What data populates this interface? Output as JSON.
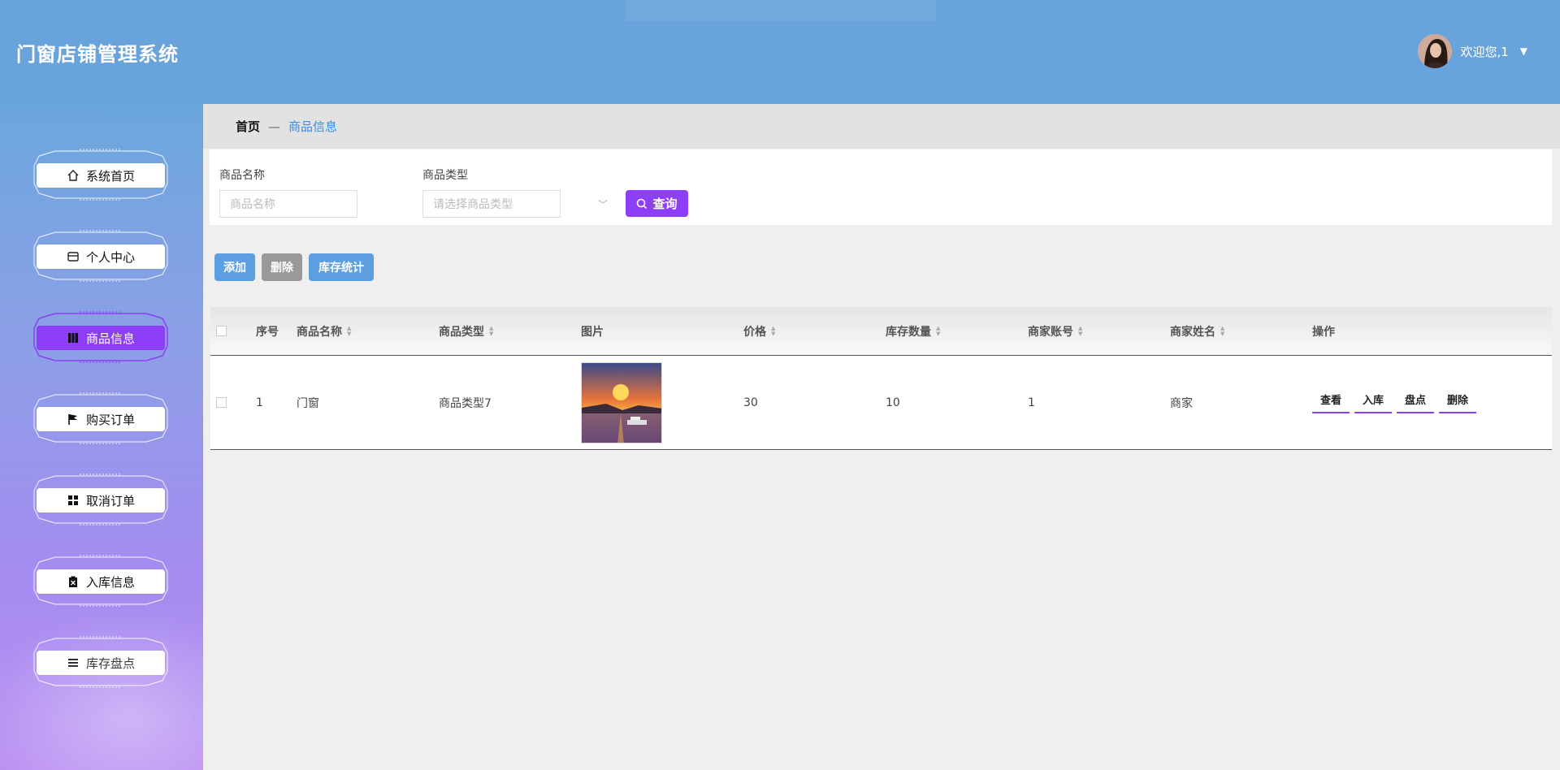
{
  "app": {
    "title": "门窗店铺管理系统"
  },
  "user": {
    "welcome": "欢迎您,1"
  },
  "sidebar": {
    "items": [
      {
        "label": "系统首页",
        "icon": "home-icon",
        "active": false
      },
      {
        "label": "个人中心",
        "icon": "wallet-icon",
        "active": false
      },
      {
        "label": "商品信息",
        "icon": "book-icon",
        "active": true
      },
      {
        "label": "购买订单",
        "icon": "flag-icon",
        "active": false
      },
      {
        "label": "取消订单",
        "icon": "grid-icon",
        "active": false
      },
      {
        "label": "入库信息",
        "icon": "clipboard-icon",
        "active": false
      },
      {
        "label": "库存盘点",
        "icon": "list-icon",
        "active": false
      }
    ]
  },
  "breadcrumb": {
    "home": "首页",
    "separator": "—",
    "current": "商品信息"
  },
  "search": {
    "name_label": "商品名称",
    "name_placeholder": "商品名称",
    "type_label": "商品类型",
    "type_placeholder": "请选择商品类型",
    "query_label": "查询"
  },
  "actions": {
    "add": "添加",
    "delete": "删除",
    "stats": "库存统计"
  },
  "table": {
    "headers": [
      "序号",
      "商品名称",
      "商品类型",
      "图片",
      "价格",
      "库存数量",
      "商家账号",
      "商家姓名",
      "操作"
    ],
    "rows": [
      {
        "index": "1",
        "name": "门窗",
        "type": "商品类型7",
        "price": "30",
        "stock": "10",
        "merchant_account": "1",
        "merchant_name": "商家",
        "ops": [
          "查看",
          "入库",
          "盘点",
          "删除"
        ]
      }
    ]
  },
  "colors": {
    "header": "#68a3dc",
    "accent": "#8d3ef7",
    "action_blue": "#5d9ee0",
    "action_gray": "#999999"
  }
}
